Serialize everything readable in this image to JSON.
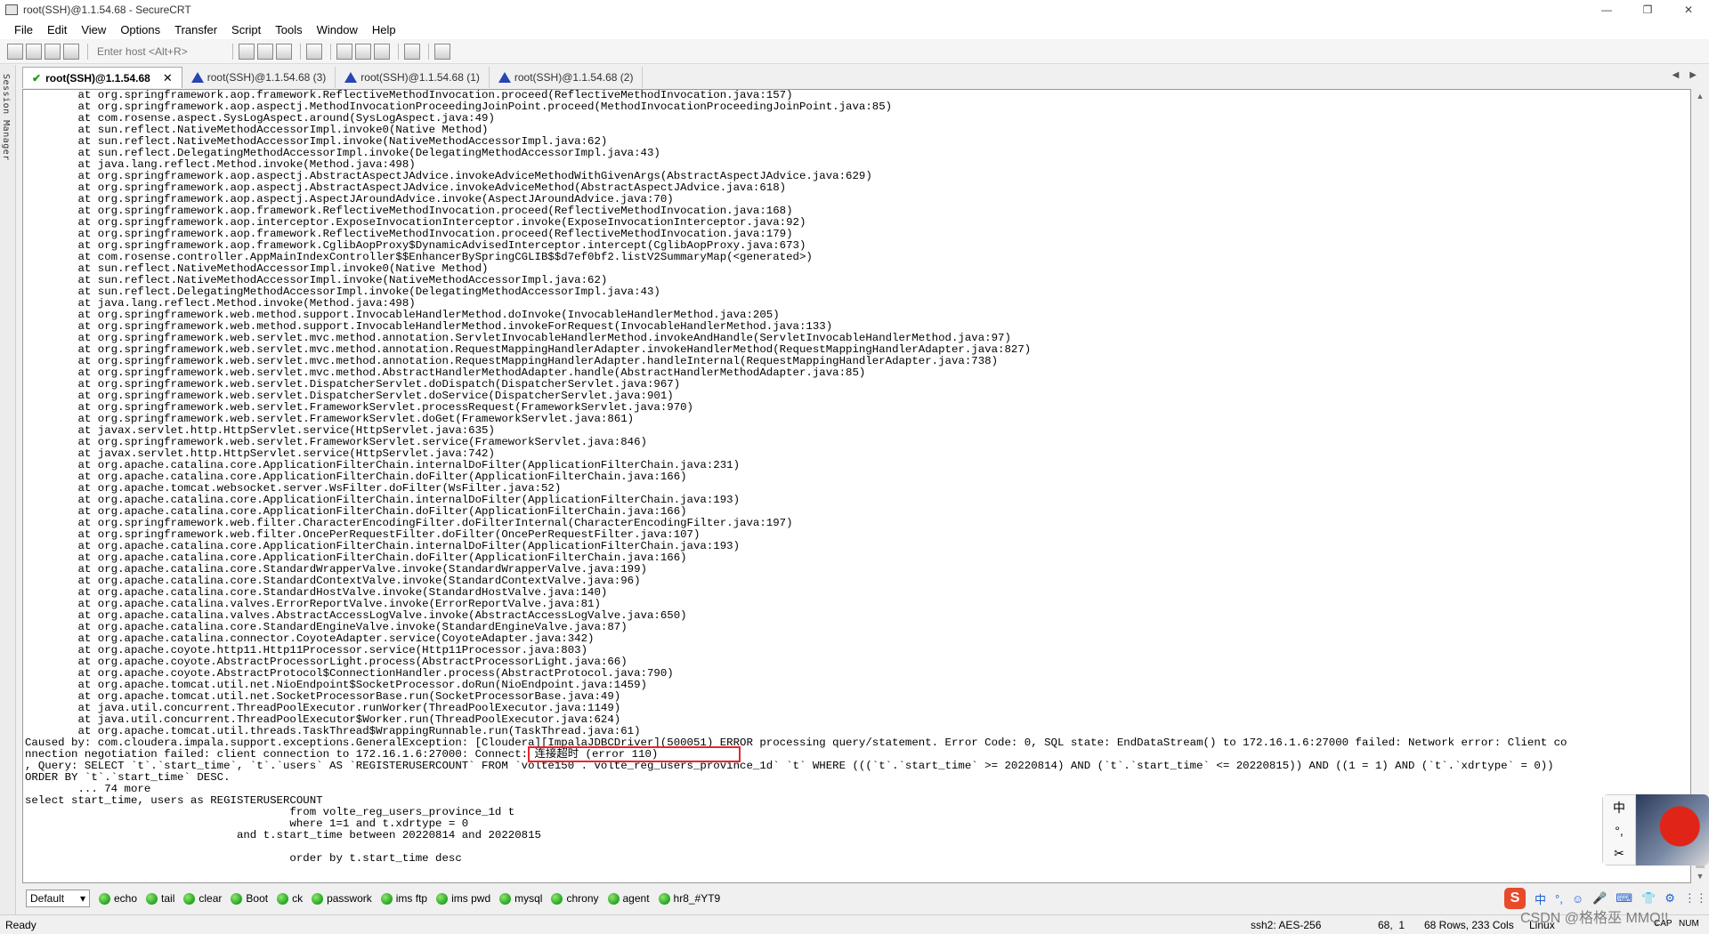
{
  "window": {
    "title": "root(SSH)@1.1.54.68 - SecureCRT",
    "controls": {
      "minimize": "—",
      "restore": "❐",
      "close": "✕"
    }
  },
  "menu": [
    "File",
    "Edit",
    "View",
    "Options",
    "Transfer",
    "Script",
    "Tools",
    "Window",
    "Help"
  ],
  "toolbar": {
    "host_placeholder": "Enter host <Alt+R>"
  },
  "session_manager": {
    "label": "Session Manager"
  },
  "tabs": [
    {
      "label": "root(SSH)@1.1.54.68",
      "active": true,
      "status_icon": "check-icon"
    },
    {
      "label": "root(SSH)@1.1.54.68 (3)",
      "active": false,
      "status_icon": "warning-icon"
    },
    {
      "label": "root(SSH)@1.1.54.68 (1)",
      "active": false,
      "status_icon": "warning-icon"
    },
    {
      "label": "root(SSH)@1.1.54.68 (2)",
      "active": false,
      "status_icon": "warning-icon"
    }
  ],
  "terminal": {
    "lines": [
      "        at org.springframework.aop.framework.ReflectiveMethodInvocation.proceed(ReflectiveMethodInvocation.java:157)",
      "        at org.springframework.aop.aspectj.MethodInvocationProceedingJoinPoint.proceed(MethodInvocationProceedingJoinPoint.java:85)",
      "        at com.rosense.aspect.SysLogAspect.around(SysLogAspect.java:49)",
      "        at sun.reflect.NativeMethodAccessorImpl.invoke0(Native Method)",
      "        at sun.reflect.NativeMethodAccessorImpl.invoke(NativeMethodAccessorImpl.java:62)",
      "        at sun.reflect.DelegatingMethodAccessorImpl.invoke(DelegatingMethodAccessorImpl.java:43)",
      "        at java.lang.reflect.Method.invoke(Method.java:498)",
      "        at org.springframework.aop.aspectj.AbstractAspectJAdvice.invokeAdviceMethodWithGivenArgs(AbstractAspectJAdvice.java:629)",
      "        at org.springframework.aop.aspectj.AbstractAspectJAdvice.invokeAdviceMethod(AbstractAspectJAdvice.java:618)",
      "        at org.springframework.aop.aspectj.AspectJAroundAdvice.invoke(AspectJAroundAdvice.java:70)",
      "        at org.springframework.aop.framework.ReflectiveMethodInvocation.proceed(ReflectiveMethodInvocation.java:168)",
      "        at org.springframework.aop.interceptor.ExposeInvocationInterceptor.invoke(ExposeInvocationInterceptor.java:92)",
      "        at org.springframework.aop.framework.ReflectiveMethodInvocation.proceed(ReflectiveMethodInvocation.java:179)",
      "        at org.springframework.aop.framework.CglibAopProxy$DynamicAdvisedInterceptor.intercept(CglibAopProxy.java:673)",
      "        at com.rosense.controller.AppMainIndexController$$EnhancerBySpringCGLIB$$d7ef0bf2.listV2SummaryMap(<generated>)",
      "        at sun.reflect.NativeMethodAccessorImpl.invoke0(Native Method)",
      "        at sun.reflect.NativeMethodAccessorImpl.invoke(NativeMethodAccessorImpl.java:62)",
      "        at sun.reflect.DelegatingMethodAccessorImpl.invoke(DelegatingMethodAccessorImpl.java:43)",
      "        at java.lang.reflect.Method.invoke(Method.java:498)",
      "        at org.springframework.web.method.support.InvocableHandlerMethod.doInvoke(InvocableHandlerMethod.java:205)",
      "        at org.springframework.web.method.support.InvocableHandlerMethod.invokeForRequest(InvocableHandlerMethod.java:133)",
      "        at org.springframework.web.servlet.mvc.method.annotation.ServletInvocableHandlerMethod.invokeAndHandle(ServletInvocableHandlerMethod.java:97)",
      "        at org.springframework.web.servlet.mvc.method.annotation.RequestMappingHandlerAdapter.invokeHandlerMethod(RequestMappingHandlerAdapter.java:827)",
      "        at org.springframework.web.servlet.mvc.method.annotation.RequestMappingHandlerAdapter.handleInternal(RequestMappingHandlerAdapter.java:738)",
      "        at org.springframework.web.servlet.mvc.method.AbstractHandlerMethodAdapter.handle(AbstractHandlerMethodAdapter.java:85)",
      "        at org.springframework.web.servlet.DispatcherServlet.doDispatch(DispatcherServlet.java:967)",
      "        at org.springframework.web.servlet.DispatcherServlet.doService(DispatcherServlet.java:901)",
      "        at org.springframework.web.servlet.FrameworkServlet.processRequest(FrameworkServlet.java:970)",
      "        at org.springframework.web.servlet.FrameworkServlet.doGet(FrameworkServlet.java:861)",
      "        at javax.servlet.http.HttpServlet.service(HttpServlet.java:635)",
      "        at org.springframework.web.servlet.FrameworkServlet.service(FrameworkServlet.java:846)",
      "        at javax.servlet.http.HttpServlet.service(HttpServlet.java:742)",
      "        at org.apache.catalina.core.ApplicationFilterChain.internalDoFilter(ApplicationFilterChain.java:231)",
      "        at org.apache.catalina.core.ApplicationFilterChain.doFilter(ApplicationFilterChain.java:166)",
      "        at org.apache.tomcat.websocket.server.WsFilter.doFilter(WsFilter.java:52)",
      "        at org.apache.catalina.core.ApplicationFilterChain.internalDoFilter(ApplicationFilterChain.java:193)",
      "        at org.apache.catalina.core.ApplicationFilterChain.doFilter(ApplicationFilterChain.java:166)",
      "        at org.springframework.web.filter.CharacterEncodingFilter.doFilterInternal(CharacterEncodingFilter.java:197)",
      "        at org.springframework.web.filter.OncePerRequestFilter.doFilter(OncePerRequestFilter.java:107)",
      "        at org.apache.catalina.core.ApplicationFilterChain.internalDoFilter(ApplicationFilterChain.java:193)",
      "        at org.apache.catalina.core.ApplicationFilterChain.doFilter(ApplicationFilterChain.java:166)",
      "        at org.apache.catalina.core.StandardWrapperValve.invoke(StandardWrapperValve.java:199)",
      "        at org.apache.catalina.core.StandardContextValve.invoke(StandardContextValve.java:96)",
      "        at org.apache.catalina.core.StandardHostValve.invoke(StandardHostValve.java:140)",
      "        at org.apache.catalina.valves.ErrorReportValve.invoke(ErrorReportValve.java:81)",
      "        at org.apache.catalina.valves.AbstractAccessLogValve.invoke(AbstractAccessLogValve.java:650)",
      "        at org.apache.catalina.core.StandardEngineValve.invoke(StandardEngineValve.java:87)",
      "        at org.apache.catalina.connector.CoyoteAdapter.service(CoyoteAdapter.java:342)",
      "        at org.apache.coyote.http11.Http11Processor.service(Http11Processor.java:803)",
      "        at org.apache.coyote.AbstractProcessorLight.process(AbstractProcessorLight.java:66)",
      "        at org.apache.coyote.AbstractProtocol$ConnectionHandler.process(AbstractProtocol.java:790)",
      "        at org.apache.tomcat.util.net.NioEndpoint$SocketProcessor.doRun(NioEndpoint.java:1459)",
      "        at org.apache.tomcat.util.net.SocketProcessorBase.run(SocketProcessorBase.java:49)",
      "        at java.util.concurrent.ThreadPoolExecutor.runWorker(ThreadPoolExecutor.java:1149)",
      "        at java.util.concurrent.ThreadPoolExecutor$Worker.run(ThreadPoolExecutor.java:624)",
      "        at org.apache.tomcat.util.threads.TaskThread$WrappingRunnable.run(TaskThread.java:61)",
      "Caused by: com.cloudera.impala.support.exceptions.GeneralException: [Cloudera][ImpalaJDBCDriver](500051) ERROR processing query/statement. Error Code: 0, SQL state: EndDataStream() to 172.16.1.6:27000 failed: Network error: Client co",
      "nnection negotiation failed: client connection to 172.16.1.6:27000: Connect: 连接超时 (error 110)",
      ", Query: SELECT `t`.`start_time`, `t`.`users` AS `REGISTERUSERCOUNT` FROM `volte150`.`volte_reg_users_province_1d` `t` WHERE (((`t`.`start_time` >= 20220814) AND (`t`.`start_time` <= 20220815)) AND ((1 = 1) AND (`t`.`xdrtype` = 0))",
      "ORDER BY `t`.`start_time` DESC.",
      "        ... 74 more",
      "select start_time, users as REGISTERUSERCOUNT",
      "                                        from volte_reg_users_province_1d t",
      "                                        where 1=1 and t.xdrtype = 0",
      "                                and t.start_time between 20220814 and 20220815",
      "",
      "                                        order by t.start_time desc"
    ]
  },
  "button_bar": {
    "selector": "Default",
    "buttons": [
      "echo",
      "tail",
      "clear",
      "Boot",
      "ck",
      "passwork",
      "ims ftp",
      "ims pwd",
      "mysql",
      "chrony",
      "agent",
      "hr8_#YT9"
    ]
  },
  "ime": {
    "logo": "S",
    "items": [
      "中",
      "°,",
      "☺",
      "🎤",
      "⌨",
      "👕",
      "⚙",
      "⋮⋮"
    ],
    "vertical": [
      "中",
      "°,",
      "✂"
    ]
  },
  "watermark": "CSDN @格格巫 MMQ!!",
  "status": {
    "ready": "Ready",
    "cipher": "ssh2: AES-256",
    "cursor": "68,  1",
    "size": "68 Rows, 233 Cols",
    "os": "Linux",
    "caps": "CAP",
    "num": "NUM"
  },
  "colors": {
    "highlight_border": "#e8262b",
    "button_dot": "#22a322",
    "tab_warn": "#2646b4"
  }
}
